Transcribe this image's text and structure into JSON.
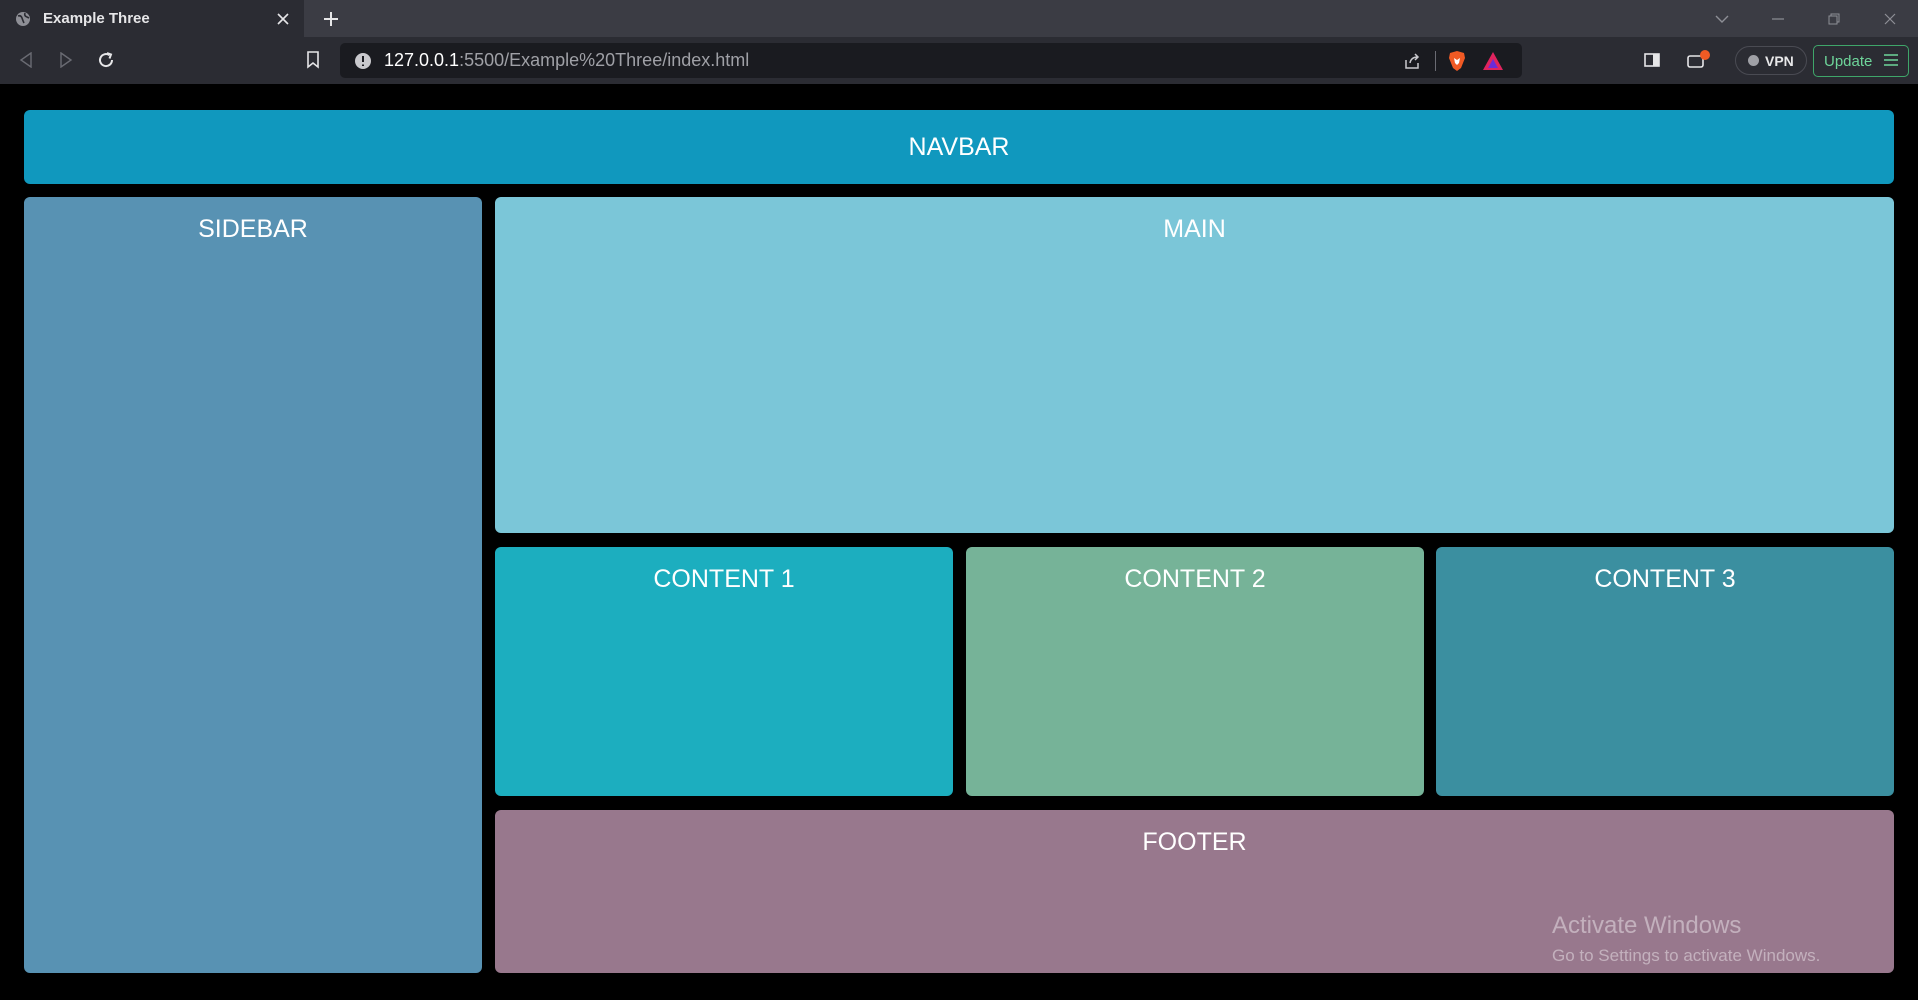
{
  "browser": {
    "tab": {
      "title": "Example Three",
      "favicon": "globe-icon"
    },
    "url": {
      "host": "127.0.0.1",
      "path": ":5500/Example%20Three/index.html"
    },
    "vpn_label": "VPN",
    "update_label": "Update",
    "colors": {
      "tabstrip": "#3b3c44",
      "toolbar": "#2b2c33",
      "urlbar": "#1a1b20",
      "update_accent": "#6ed59a"
    }
  },
  "page": {
    "navbar": "NAVBAR",
    "sidebar": "SIDEBAR",
    "main": "MAIN",
    "content_1": "CONTENT 1",
    "content_2": "CONTENT 2",
    "content_3": "CONTENT 3",
    "footer": "FOOTER",
    "colors": {
      "background": "#000000",
      "navbar": "#1098be",
      "sidebar": "#5892b3",
      "main": "#7bc6d8",
      "content_1": "#1caebf",
      "content_2": "#76b398",
      "content_3": "#3b8fa0",
      "footer": "#98788d"
    }
  },
  "watermark": {
    "title": "Activate Windows",
    "subtitle": "Go to Settings to activate Windows."
  }
}
